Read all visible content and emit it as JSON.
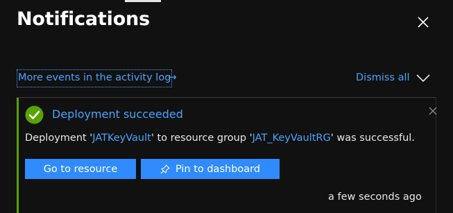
{
  "panel": {
    "title": "Notifications"
  },
  "actions": {
    "activity_link": "More events in the activity log",
    "activity_arrow": "→",
    "dismiss_all": "Dismiss all"
  },
  "notification": {
    "status": "success",
    "title": "Deployment succeeded",
    "message": {
      "part1": "Deployment '",
      "resource": "JATKeyVault",
      "part2": "' to resource group '",
      "group": "JAT_KeyVaultRG",
      "part3": "' was successful."
    },
    "buttons": {
      "go_to_resource": "Go to resource",
      "pin_to_dashboard": "Pin to dashboard"
    },
    "time": "a few seconds ago"
  },
  "icons": {
    "close": "close-icon",
    "chevron": "chevron-down-icon",
    "success": "check-circle-icon",
    "pin": "pin-icon",
    "dismiss": "dismiss-icon"
  },
  "colors": {
    "background": "#111111",
    "link": "#4aa3ff",
    "button": "#2f8bff",
    "success": "#57a300",
    "text": "#e8e8e8"
  }
}
